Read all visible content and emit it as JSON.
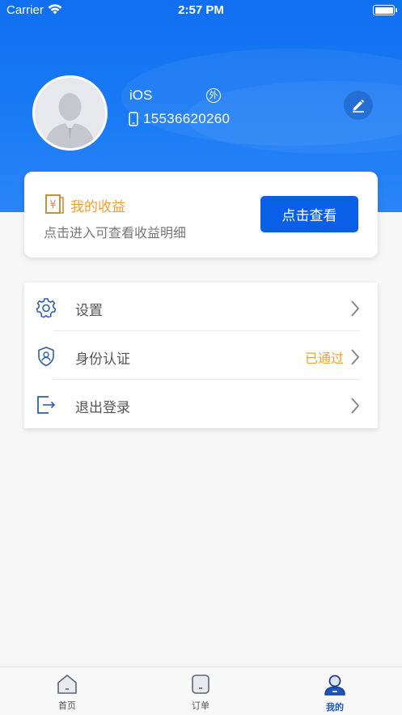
{
  "status_bar": {
    "carrier": "Carrier",
    "time": "2:57 PM"
  },
  "profile": {
    "username": "iOS",
    "badge": "外",
    "phone": "15536620260"
  },
  "earnings": {
    "title": "我的收益",
    "subtitle": "点击进入可查看收益明细",
    "button_label": "点击查看",
    "title_color": "#f0a030",
    "button_color": "#0a5fe8"
  },
  "menu": {
    "items": [
      {
        "label": "设置",
        "icon": "gear-icon",
        "status": ""
      },
      {
        "label": "身份认证",
        "icon": "shield-user-icon",
        "status": "已通过"
      },
      {
        "label": "退出登录",
        "icon": "logout-icon",
        "status": ""
      }
    ]
  },
  "tabbar": {
    "tabs": [
      {
        "label": "首页",
        "icon": "home-icon",
        "active": false
      },
      {
        "label": "订单",
        "icon": "order-icon",
        "active": false
      },
      {
        "label": "我的",
        "icon": "profile-icon",
        "active": true
      }
    ]
  },
  "colors": {
    "header_blue": "#0f6ff0",
    "accent_orange": "#f0a030",
    "tab_active": "#1b55c8"
  }
}
